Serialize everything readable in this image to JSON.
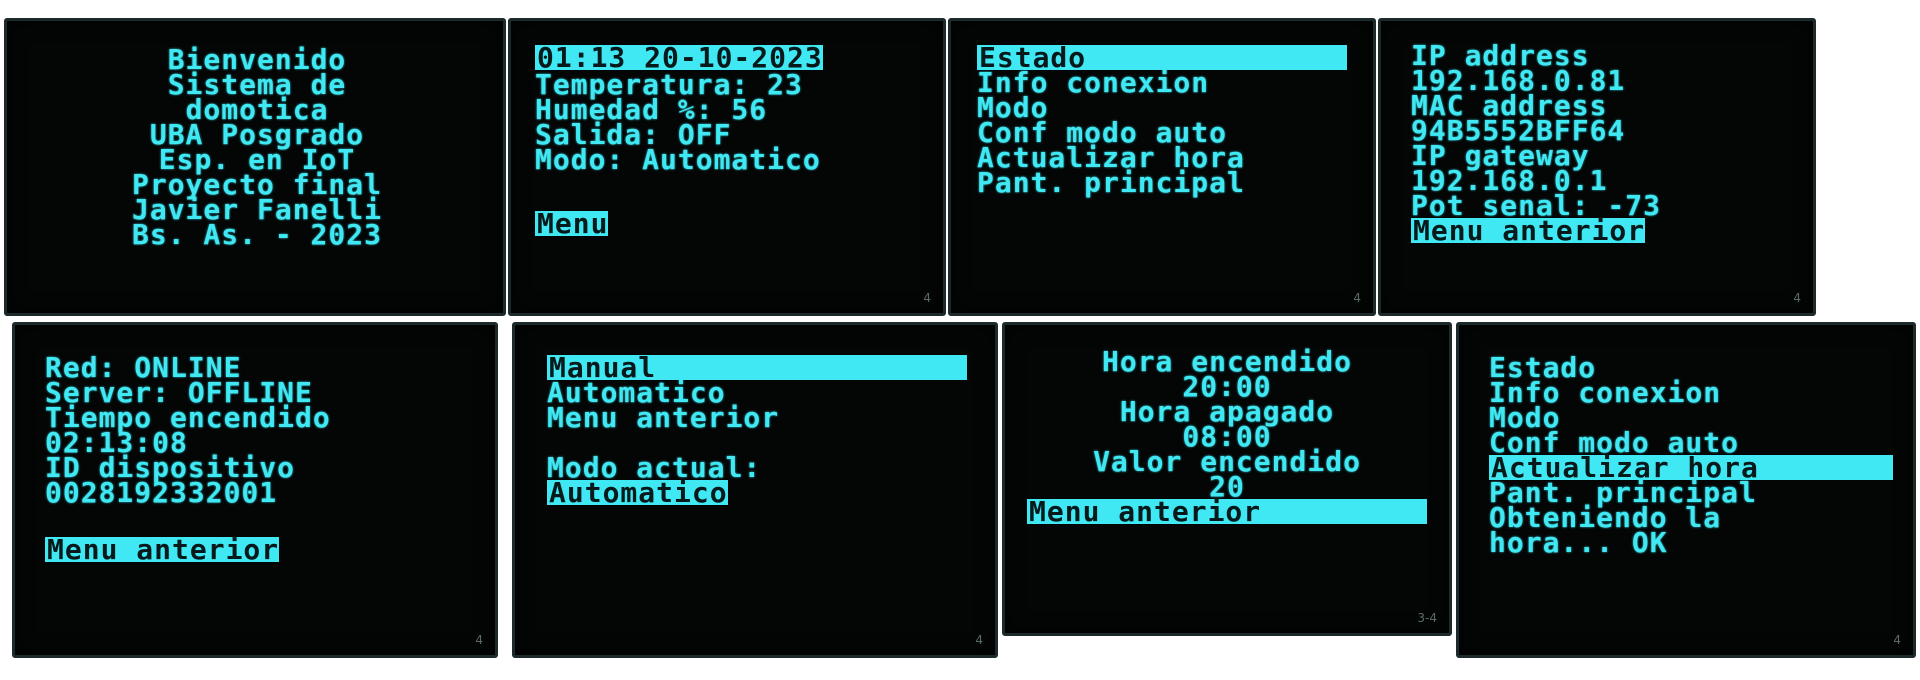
{
  "panel_marks": [
    "4",
    "4",
    "4",
    "4",
    "4",
    "3-4",
    "4"
  ],
  "screen_welcome": {
    "lines": [
      "Bienvenido",
      "Sistema de",
      "domotica",
      "UBA Posgrado",
      "Esp. en IoT",
      "Proyecto final",
      "Javier Fanelli",
      "Bs. As. - 2023"
    ]
  },
  "screen_main": {
    "datetime": "01:13 20-10-2023",
    "temperature": "Temperatura: 23",
    "humidity": "Humedad %: 56",
    "output": "Salida: OFF",
    "mode": "Modo: Automatico",
    "menu": "Menu"
  },
  "screen_menu": {
    "items": [
      "Estado",
      "Info conexion",
      "Modo",
      "Conf modo auto",
      "Actualizar hora",
      "Pant. principal"
    ],
    "selected": "Estado"
  },
  "screen_network": {
    "lines": [
      "IP address",
      "192.168.0.81",
      "MAC address",
      "94B5552BFF64",
      "IP gateway",
      "192.168.0.1",
      "Pot senal: -73"
    ],
    "back": "Menu anterior"
  },
  "screen_status": {
    "lines": [
      "Red: ONLINE",
      "Server: OFFLINE",
      "Tiempo encendido",
      "02:13:08",
      "ID dispositivo",
      "0028192332001"
    ],
    "back": "Menu anterior"
  },
  "screen_mode": {
    "options": [
      "Manual",
      "Automatico",
      "Menu anterior"
    ],
    "selected": "Manual",
    "current_label": "Modo actual:",
    "current_value": "Automatico"
  },
  "screen_auto_config": {
    "on_label": "Hora encendido",
    "on_time": "20:00",
    "off_label": "Hora apagado",
    "off_time": "08:00",
    "value_label": "Valor encendido",
    "value": "20",
    "back": "Menu anterior"
  },
  "screen_update_time": {
    "items": [
      "Estado",
      "Info conexion",
      "Modo",
      "Conf modo auto",
      "Actualizar hora",
      "Pant. principal"
    ],
    "selected": "Actualizar hora",
    "status": [
      "Obteniendo la",
      "hora... OK"
    ]
  }
}
